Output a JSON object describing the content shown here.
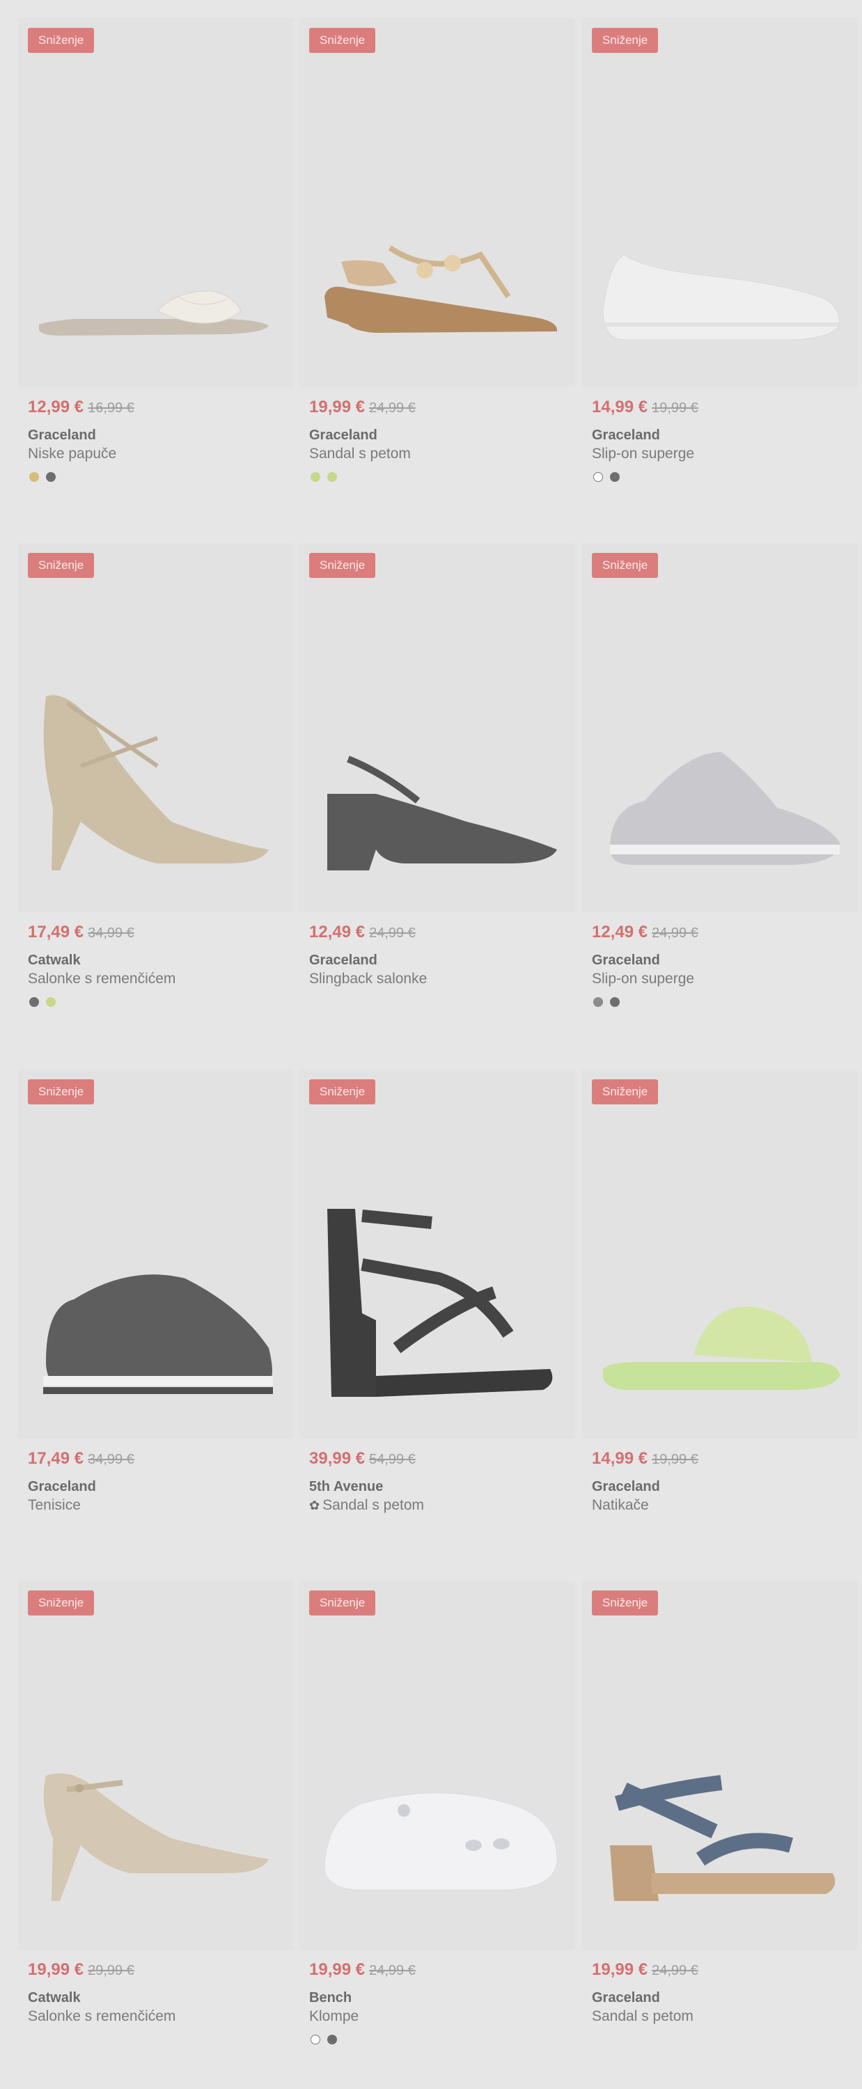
{
  "badge_label": "Sniženje",
  "products": [
    {
      "price_new": "12,99 €",
      "price_old": "16,99 €",
      "brand": "Graceland",
      "name": "Niske papuče",
      "image": "flat-slide-icon",
      "swatches": [
        "gold",
        "gray"
      ]
    },
    {
      "price_new": "19,99 €",
      "price_old": "24,99 €",
      "brand": "Graceland",
      "name": "Sandal s petom",
      "image": "wedge-sandal-icon",
      "swatches": [
        "lime",
        "lime"
      ]
    },
    {
      "price_new": "14,99 €",
      "price_old": "19,99 €",
      "brand": "Graceland",
      "name": "Slip-on superge",
      "image": "white-sneaker-icon",
      "swatches": [
        "white",
        "gray"
      ]
    },
    {
      "price_new": "17,49 €",
      "price_old": "34,99 €",
      "brand": "Catwalk",
      "name": "Salonke s remenčićem",
      "image": "glitter-heel-icon",
      "swatches": [
        "gray",
        "lime"
      ]
    },
    {
      "price_new": "12,49 €",
      "price_old": "24,99 €",
      "brand": "Graceland",
      "name": "Slingback salonke",
      "image": "slingback-heel-icon",
      "swatches": []
    },
    {
      "price_new": "12,49 €",
      "price_old": "24,99 €",
      "brand": "Graceland",
      "name": "Slip-on superge",
      "image": "knit-sneaker-icon",
      "swatches": [
        "silver",
        "gray"
      ]
    },
    {
      "price_new": "17,49 €",
      "price_old": "34,99 €",
      "brand": "Graceland",
      "name": "Tenisice",
      "image": "platform-sneaker-icon",
      "swatches": []
    },
    {
      "price_new": "39,99 €",
      "price_old": "54,99 €",
      "brand": "5th Avenue",
      "name": "Sandal s petom",
      "image": "strappy-block-sandal-icon",
      "swatches": [],
      "name_icon": "sustainable-icon"
    },
    {
      "price_new": "14,99 €",
      "price_old": "19,99 €",
      "brand": "Graceland",
      "name": "Natikače",
      "image": "lime-slide-icon",
      "swatches": []
    },
    {
      "price_new": "19,99 €",
      "price_old": "29,99 €",
      "brand": "Catwalk",
      "name": "Salonke s remenčićem",
      "image": "beige-heel-icon",
      "swatches": []
    },
    {
      "price_new": "19,99 €",
      "price_old": "24,99 €",
      "brand": "Bench",
      "name": "Klompe",
      "image": "white-clog-icon",
      "swatches": [
        "white",
        "gray"
      ]
    },
    {
      "price_new": "19,99 €",
      "price_old": "24,99 €",
      "brand": "Graceland",
      "name": "Sandal s petom",
      "image": "blue-block-sandal-icon",
      "swatches": []
    }
  ],
  "colors": {
    "badge": "#db7d7d",
    "price": "#d56f6f",
    "background": "#e6e6e6"
  }
}
